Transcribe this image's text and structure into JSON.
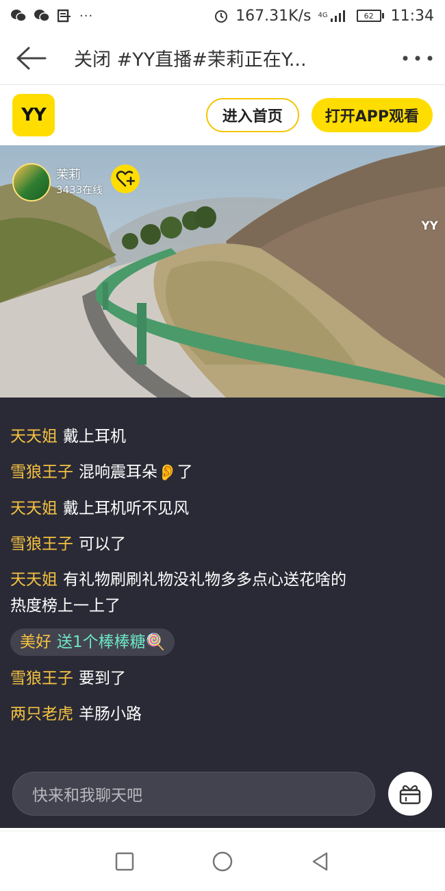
{
  "status_bar": {
    "left_icons": [
      "wechat-icon",
      "wechat-icon",
      "message-icon",
      "more-dots-icon"
    ],
    "speed": "167.31K/s",
    "network": "4G",
    "battery": "62",
    "time": "11:34"
  },
  "app_bar": {
    "title": "关闭 #YY直播#茉莉正在Y..."
  },
  "yy_header": {
    "logo": "YY",
    "home_button": "进入首页",
    "open_app_button": "打开APP观看"
  },
  "video": {
    "anchor_name": "茉莉",
    "online_count": "3433在线",
    "watermark": "YY"
  },
  "chat": {
    "messages": [
      {
        "user": "天天姐",
        "text": "戴上耳机"
      },
      {
        "user": "雪狼王子",
        "text": "混响震耳朵",
        "emoji": "👂",
        "suffix": "了"
      },
      {
        "user": "天天姐",
        "text": "戴上耳机听不见风"
      },
      {
        "user": "雪狼王子",
        "text": "可以了"
      },
      {
        "user": "天天姐",
        "text": "有礼物刷刷礼物没礼物多多点心送花啥的热度榜上一上了"
      },
      {
        "user": "美好",
        "text": "送1个棒棒糖",
        "emoji": "🍭",
        "type": "gift"
      },
      {
        "user": "雪狼王子",
        "text": "要到了"
      },
      {
        "user": "两只老虎",
        "text": "羊肠小路"
      }
    ],
    "input_placeholder": "快来和我聊天吧"
  },
  "colors": {
    "brand_yellow": "#ffdd00",
    "chat_bg": "#2a2a36",
    "username": "#f5c242",
    "gift_text": "#6ee7c5"
  }
}
